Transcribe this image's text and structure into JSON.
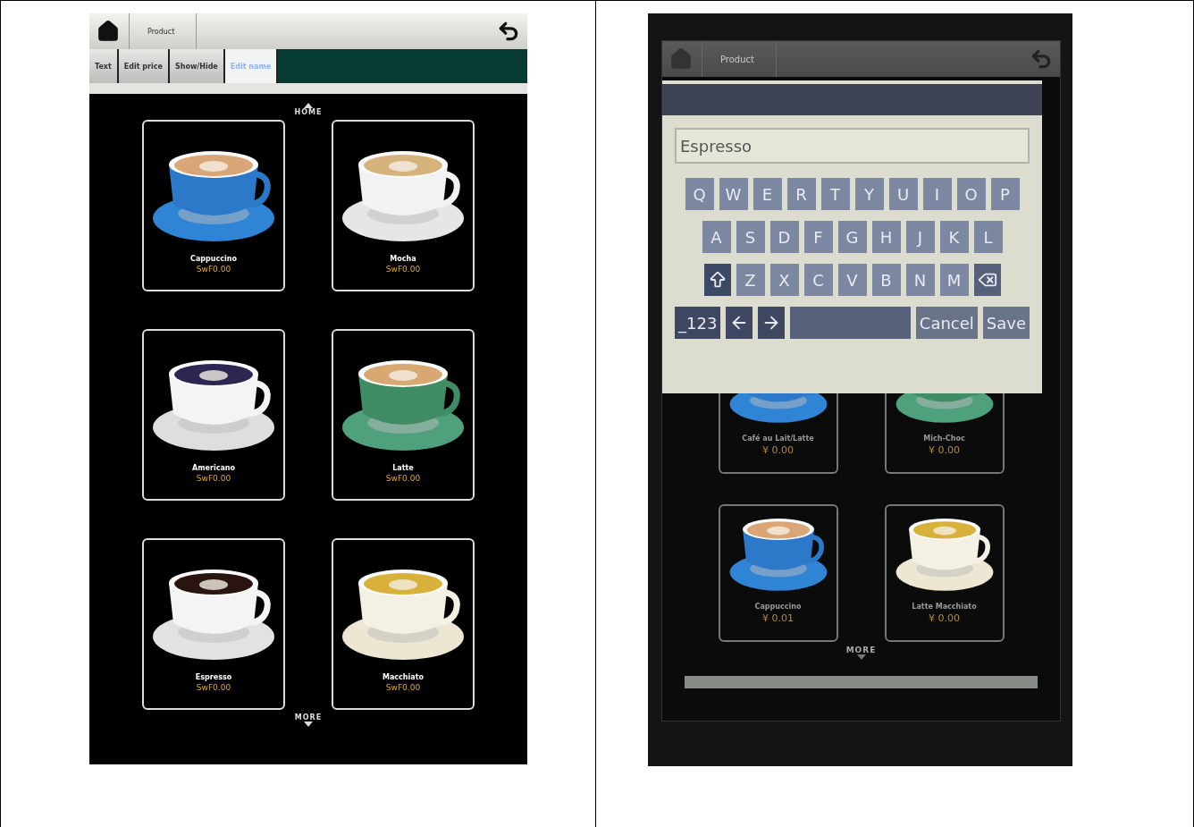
{
  "left_screen": {
    "breadcrumb": "Product",
    "tabs": [
      {
        "label": "Text",
        "selected": false
      },
      {
        "label": "Edit price",
        "selected": false
      },
      {
        "label": "Show/Hide",
        "selected": false
      },
      {
        "label": "Edit name",
        "selected": true
      }
    ],
    "nav_up": "HOME",
    "products": [
      {
        "name": "Cappuccino",
        "price": "SwF0.00"
      },
      {
        "name": "Mocha",
        "price": "SwF0.00"
      },
      {
        "name": "Americano",
        "price": "SwF0.00"
      },
      {
        "name": "Latte",
        "price": "SwF0.00"
      },
      {
        "name": "Espresso",
        "price": "SwF0.00"
      },
      {
        "name": "Macchiato",
        "price": "SwF0.00"
      }
    ],
    "nav_down": "MORE"
  },
  "right_screen": {
    "breadcrumb": "Product",
    "dialog": {
      "input": {
        "value": "Espresso"
      },
      "key_rows": [
        [
          {
            "kind": "char",
            "label": "Q"
          },
          {
            "kind": "char",
            "label": "W"
          },
          {
            "kind": "char",
            "label": "E"
          },
          {
            "kind": "char",
            "label": "R"
          },
          {
            "kind": "char",
            "label": "T"
          },
          {
            "kind": "char",
            "label": "Y"
          },
          {
            "kind": "char",
            "label": "U"
          },
          {
            "kind": "char",
            "label": "I"
          },
          {
            "kind": "char",
            "label": "O"
          },
          {
            "kind": "char",
            "label": "P"
          }
        ],
        [
          {
            "kind": "char",
            "label": "A"
          },
          {
            "kind": "char",
            "label": "S"
          },
          {
            "kind": "char",
            "label": "D"
          },
          {
            "kind": "char",
            "label": "F"
          },
          {
            "kind": "char",
            "label": "G"
          },
          {
            "kind": "char",
            "label": "H"
          },
          {
            "kind": "char",
            "label": "J"
          },
          {
            "kind": "char",
            "label": "K"
          },
          {
            "kind": "char",
            "label": "L"
          }
        ],
        [
          {
            "kind": "shift"
          },
          {
            "kind": "char",
            "label": "Z"
          },
          {
            "kind": "char",
            "label": "X"
          },
          {
            "kind": "char",
            "label": "C"
          },
          {
            "kind": "char",
            "label": "V"
          },
          {
            "kind": "char",
            "label": "B"
          },
          {
            "kind": "char",
            "label": "N"
          },
          {
            "kind": "char",
            "label": "M"
          },
          {
            "kind": "backspace"
          }
        ],
        [
          {
            "kind": "mode",
            "label": "_123"
          },
          {
            "kind": "left"
          },
          {
            "kind": "right"
          },
          {
            "kind": "space"
          },
          {
            "kind": "action",
            "label": "Cancel"
          },
          {
            "kind": "action",
            "label": "Save"
          }
        ]
      ]
    },
    "products": [
      {
        "name": "Café au Lait/Latte",
        "price": "¥ 0.00",
        "cut": true
      },
      {
        "name": "Mich-Choc",
        "price": "¥ 0.00",
        "cut": true
      },
      {
        "name": "Cappuccino",
        "price": "¥ 0.01",
        "cut": false
      },
      {
        "name": "Latte Macchiato",
        "price": "¥ 0.00",
        "cut": false
      }
    ],
    "nav_down": "MORE"
  }
}
